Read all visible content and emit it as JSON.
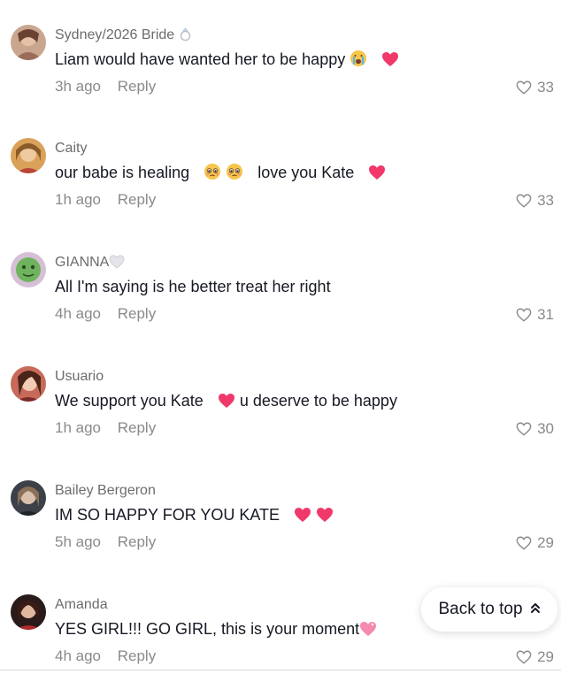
{
  "comments": [
    {
      "username": "Sydney/2026 Bride",
      "text_parts": [
        "Liam would have wanted her to be happy"
      ],
      "time": "3h ago",
      "reply": "Reply",
      "likes": "33",
      "avatar_color": "#b07a6a"
    },
    {
      "username": "Caity",
      "text_parts": [
        "our babe is healing",
        "love you Kate"
      ],
      "time": "1h ago",
      "reply": "Reply",
      "likes": "33",
      "avatar_color": "#c8944a"
    },
    {
      "username": "GIANNA",
      "text_parts": [
        "All I'm saying is he better treat her right"
      ],
      "time": "4h ago",
      "reply": "Reply",
      "likes": "31",
      "avatar_color": "#7ab86a"
    },
    {
      "username": "Usuario",
      "text_parts": [
        "We support you Kate",
        "u deserve to be happy"
      ],
      "time": "1h ago",
      "reply": "Reply",
      "likes": "30",
      "avatar_color": "#8a4a3a"
    },
    {
      "username": "Bailey Bergeron",
      "text_parts": [
        "IM SO HAPPY FOR YOU KATE"
      ],
      "time": "5h ago",
      "reply": "Reply",
      "likes": "29",
      "avatar_color": "#4a4a4a"
    },
    {
      "username": "Amanda",
      "text_parts": [
        "YES GIRL!!! GO GIRL, this is your moment"
      ],
      "time": "4h ago",
      "reply": "Reply",
      "likes": "29",
      "avatar_color": "#5a2a2a"
    }
  ],
  "back_to_top": {
    "label": "Back to top"
  },
  "colors": {
    "heart_emoji": "#f0386a",
    "muted_text": "#8a8a8a",
    "username": "#6c6c6c"
  },
  "icons": {
    "ring": "ring-icon",
    "crying_face": "crying-face-emoji",
    "pleading_face": "pleading-face-emoji",
    "white_heart": "white-heart-emoji",
    "pink_heart": "pink-heart-emoji",
    "like": "heart-outline-icon",
    "chevron_up": "double-chevron-up-icon"
  }
}
